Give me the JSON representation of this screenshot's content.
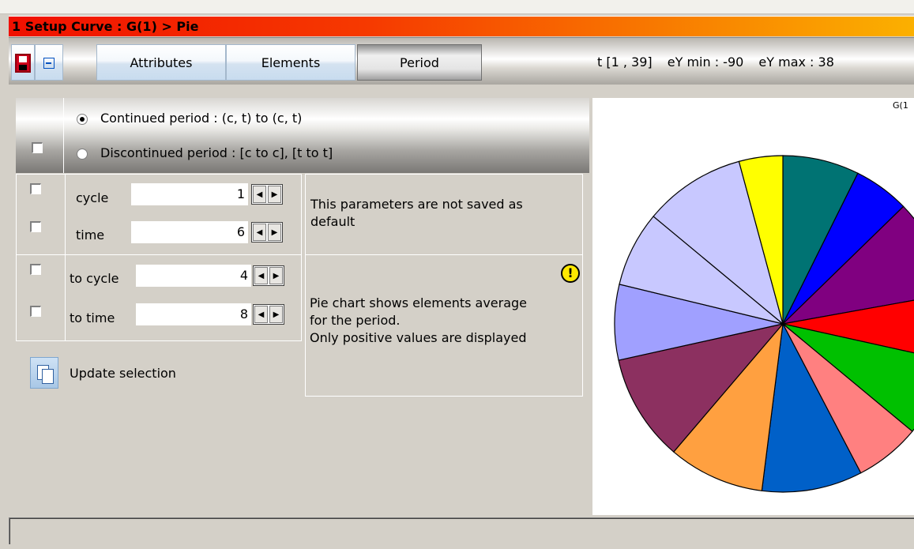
{
  "title": "1  Setup Curve : G(1) > Pie",
  "toolbar": {
    "save_icon": "save-icon",
    "collapse_icon": "collapse-icon",
    "tabs": [
      {
        "label": "Attributes",
        "active": false
      },
      {
        "label": "Elements",
        "active": false
      },
      {
        "label": "Period",
        "active": true
      }
    ],
    "t_range": "t [1 , 39]",
    "ey_min": "eY min : -90",
    "ey_max": "eY max : 38"
  },
  "period": {
    "continued_label": "Continued period : (c, t) to (c, t)",
    "continued_checked": true,
    "discontinued_label": "Discontinued period : [c to c], [t to t]",
    "discontinued_checked": false
  },
  "params": {
    "cycle_label": "cycle",
    "cycle_value": "1",
    "time_label": "time",
    "time_value": "6",
    "to_cycle_label": "to cycle",
    "to_cycle_value": "4",
    "to_time_label": "to time",
    "to_time_value": "8"
  },
  "info": {
    "not_saved_line1": "This parameters are not saved as",
    "not_saved_line2": "default",
    "pie_note_line1": "Pie chart shows elements average",
    "pie_note_line2": "for the period.",
    "pie_note_line3": "Only positive values are displayed",
    "warning_icon": "warning-icon"
  },
  "update_label": "Update selection",
  "chart_data": {
    "type": "pie",
    "title": "G(1",
    "series": [
      {
        "values": [
          7.0,
          5.1,
          9.0,
          6.0,
          7.2,
          6.0,
          9.2,
          8.8,
          9.8,
          6.9,
          6.9,
          9.3,
          4.0
        ],
        "colors": [
          "#007373",
          "#0000ff",
          "#800080",
          "#ff0000",
          "#00c000",
          "#ff8080",
          "#0060c8",
          "#ffa040",
          "#8c3060",
          "#a0a0ff",
          "#c8c8ff",
          "#c8c8ff",
          "#ffff00"
        ]
      }
    ]
  }
}
